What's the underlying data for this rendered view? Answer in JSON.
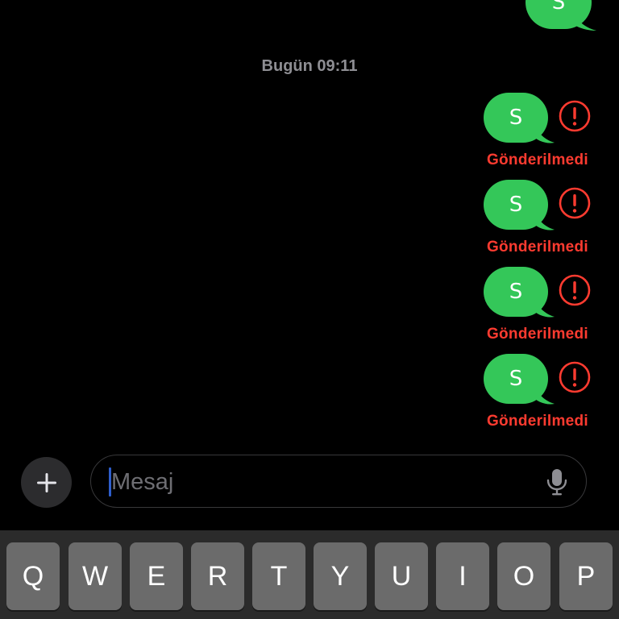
{
  "top_partial_message": {
    "text": "S"
  },
  "timestamp": "Bugün 09:11",
  "messages": [
    {
      "text": "S",
      "status": "Gönderilmedi"
    },
    {
      "text": "S",
      "status": "Gönderilmedi"
    },
    {
      "text": "S",
      "status": "Gönderilmedi"
    },
    {
      "text": "S",
      "status": "Gönderilmedi"
    }
  ],
  "composer": {
    "placeholder": "Mesaj",
    "plus_icon": "plus-icon",
    "mic_icon": "microphone-icon"
  },
  "keyboard": {
    "row1": [
      "Q",
      "W",
      "E",
      "R",
      "T",
      "Y",
      "U",
      "I",
      "O",
      "P"
    ]
  },
  "colors": {
    "sent_bubble": "#34c759",
    "error": "#ff3b30",
    "background": "#000000"
  }
}
